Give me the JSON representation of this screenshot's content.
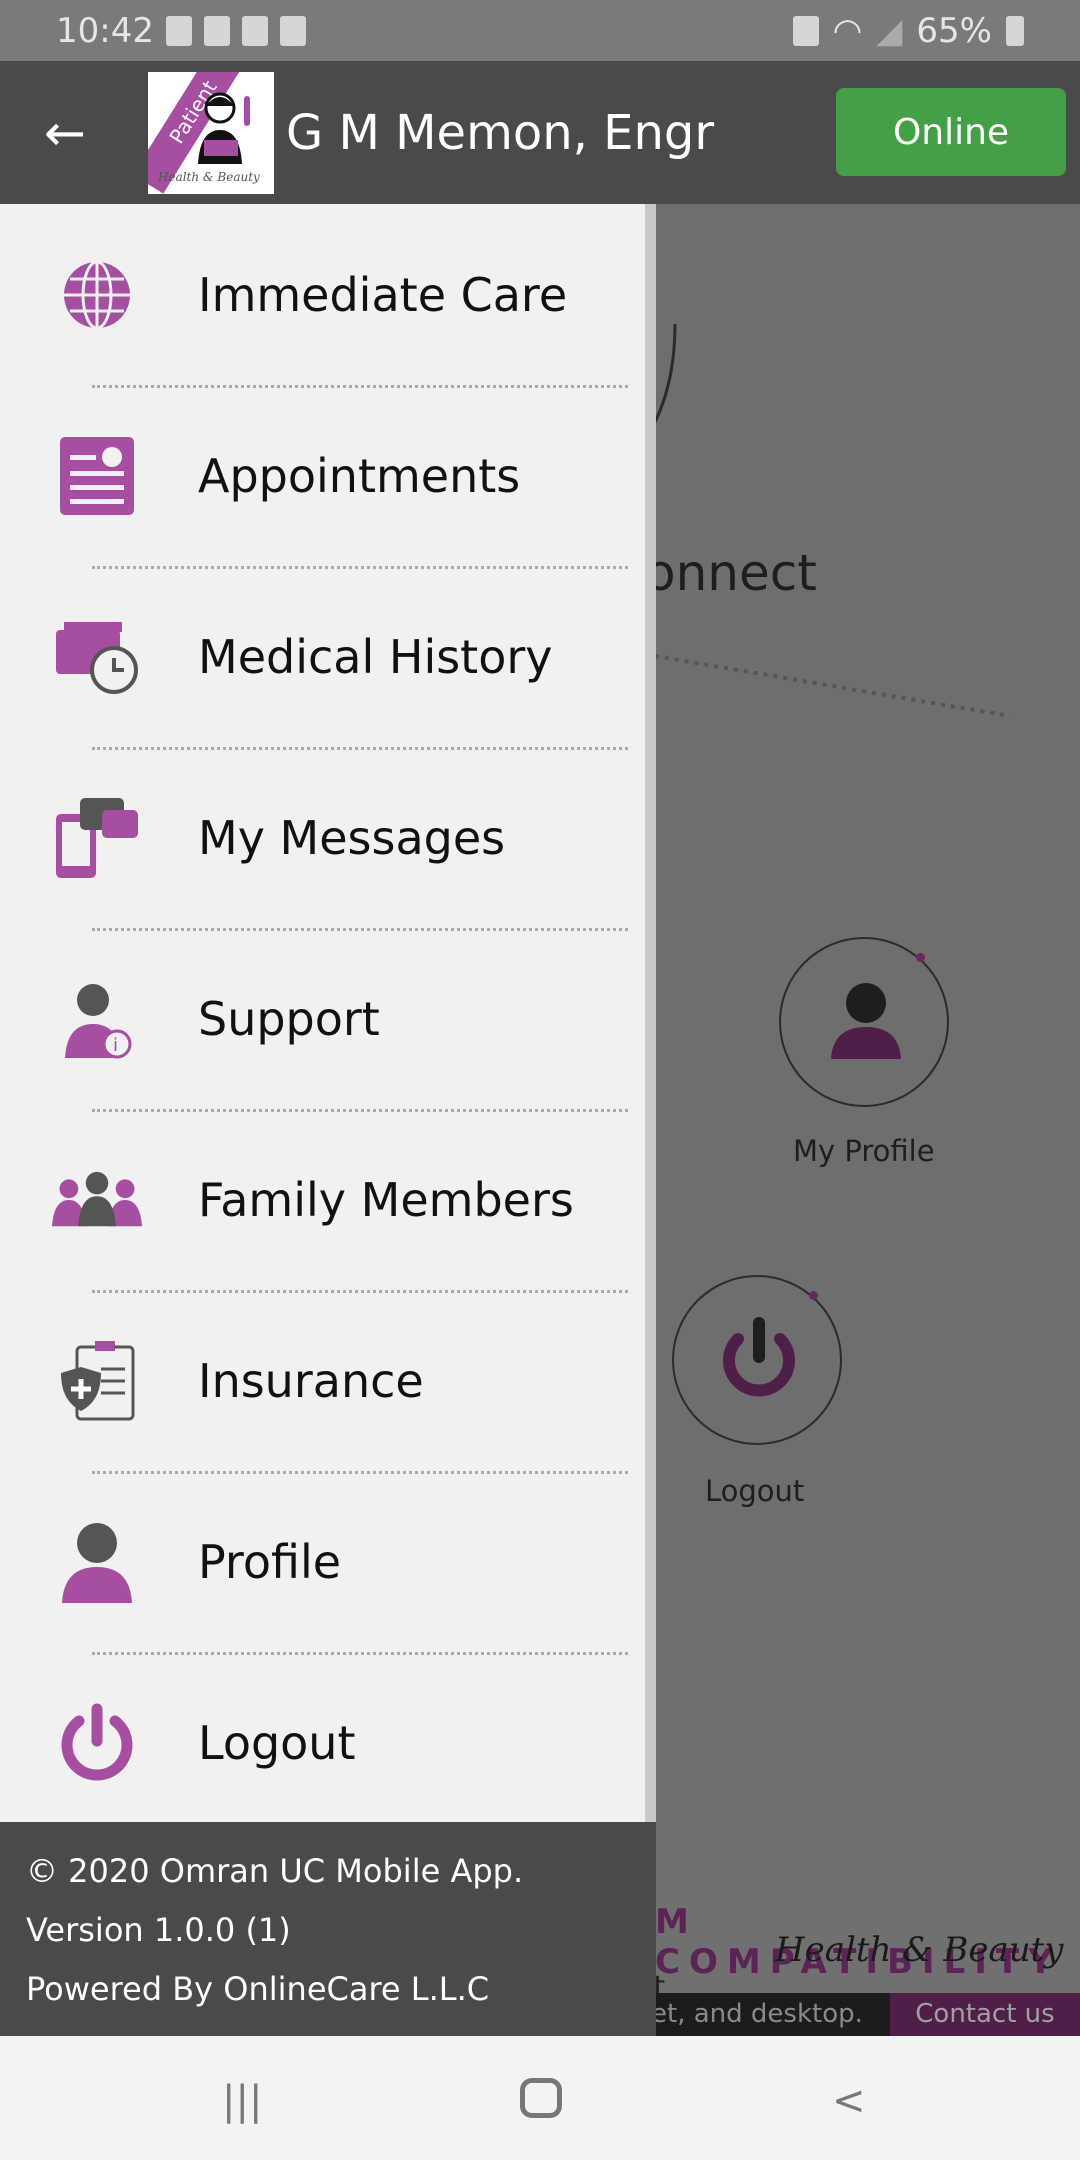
{
  "status_bar": {
    "time": "10:42",
    "battery": "65%"
  },
  "header": {
    "logo_badge": "Patient",
    "logo_caption": "Health & Beauty",
    "title": "G M Memon, Engr",
    "status_button": "Online"
  },
  "drawer": {
    "items": [
      {
        "label": "Immediate Care",
        "icon": "globe-icon"
      },
      {
        "label": "Appointments",
        "icon": "appointment-card-icon"
      },
      {
        "label": "Medical History",
        "icon": "history-wallet-clock-icon"
      },
      {
        "label": "My Messages",
        "icon": "phone-chat-icon"
      },
      {
        "label": "Support",
        "icon": "support-agent-icon"
      },
      {
        "label": "Family Members",
        "icon": "family-group-icon"
      },
      {
        "label": "Insurance",
        "icon": "insurance-clipboard-icon"
      },
      {
        "label": "Profile",
        "icon": "person-icon"
      },
      {
        "label": "Logout",
        "icon": "power-icon"
      }
    ]
  },
  "footer": {
    "copyright": "© 2020 Omran UC  Mobile App.",
    "version": "Version 1.0.0 (1)",
    "powered": "Powered By OnlineCare L.L.C"
  },
  "background": {
    "connect_text": "onnect",
    "my_profile": "My Profile",
    "logout": "Logout",
    "banner_title": "M COMPATIBILITY",
    "banner_logo": "Health & Beauty",
    "banner_sub": "it.",
    "strip_text": "et, and desktop.",
    "contact": "Contact us"
  },
  "colors": {
    "accent": "#a64ea0",
    "online": "#43a047",
    "header": "#4a4a4a"
  }
}
